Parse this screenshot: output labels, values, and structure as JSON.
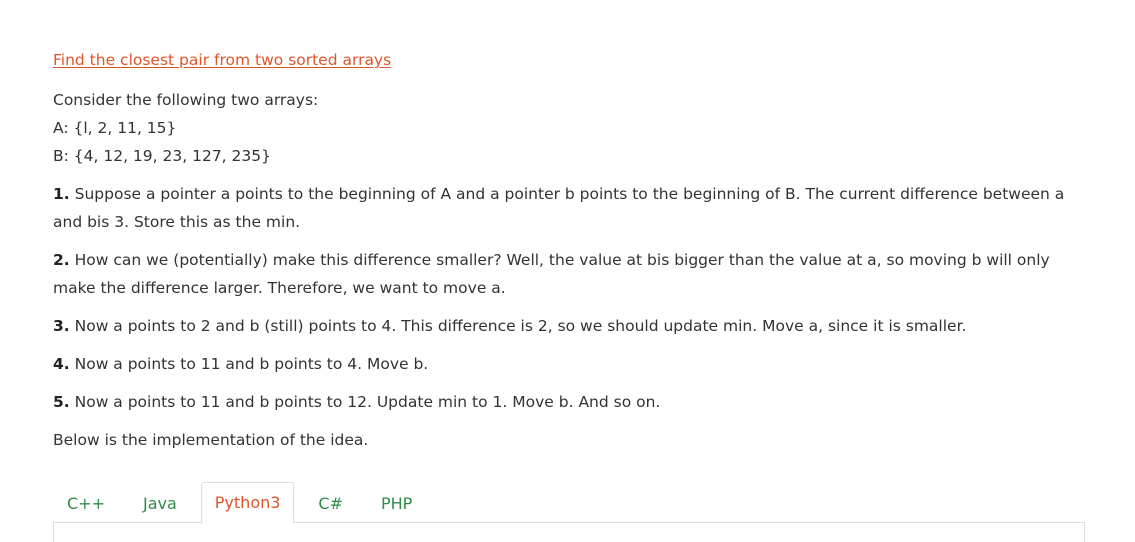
{
  "title_link": "Find the closest pair from two sorted arrays",
  "intro": {
    "line1": "Consider the following two arrays:",
    "line2": "A: {l, 2, 11, 15}",
    "line3": "B: {4, 12, 19, 23, 127, 235}"
  },
  "steps": [
    {
      "num": "1.",
      "text": " Suppose a pointer a points to the beginning of A and a pointer b points to the beginning of B. The current difference between a and bis 3. Store this as the min."
    },
    {
      "num": "2.",
      "text": " How can we (potentially) make this difference smaller? Well, the value at bis bigger than the value at a, so moving b will only make the difference larger. Therefore, we want to move a."
    },
    {
      "num": "3.",
      "text": " Now a points to 2 and b (still) points to 4. This difference is 2, so we should update min. Move a, since it is smaller."
    },
    {
      "num": "4.",
      "text": " Now a points to 11 and b points to 4. Move b."
    },
    {
      "num": "5.",
      "text": " Now a points to 11 and b points to 12. Update min to 1. Move b. And so on."
    }
  ],
  "outro": "Below is the implementation of the idea.",
  "tabs": [
    "C++",
    "Java",
    "Python3",
    "C#",
    "PHP"
  ],
  "active_tab": "Python3",
  "colors": {
    "link": "#e0552b",
    "tab": "#2f8d46",
    "active_tab": "#e0552b"
  }
}
